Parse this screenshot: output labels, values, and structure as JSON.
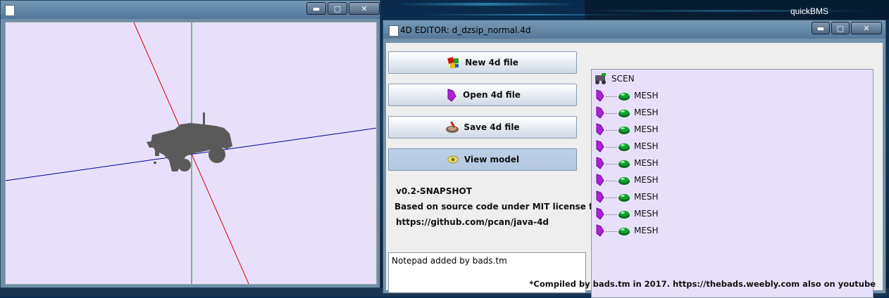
{
  "desktop": {
    "taskbar_label": "quickBMS"
  },
  "viewer_window": {
    "buttons": {
      "minimize": "▬",
      "maximize": "▢",
      "close": "✕"
    }
  },
  "editor_window": {
    "title": "4D EDITOR: d_dzsip_normal.4d",
    "buttons": {
      "minimize": "▬",
      "maximize": "▢",
      "close": "✕"
    },
    "actions": {
      "new": "New 4d file",
      "open": "Open 4d file",
      "save": "Save 4d file",
      "view": "View model"
    },
    "info": {
      "version": "v0.2-SNAPSHOT",
      "license": "Based on source code under MIT license from",
      "url": "https://github.com/pcan/java-4d"
    },
    "notepad": "Notepad added by bads.tm",
    "tree": {
      "root": "SCEN",
      "children": [
        "MESH",
        "MESH",
        "MESH",
        "MESH",
        "MESH",
        "MESH",
        "MESH",
        "MESH",
        "MESH"
      ]
    },
    "footer": "*Compiled by bads.tm in 2017. https://thebads.weebly.com also on youtube"
  },
  "colors": {
    "canvas_bg": "#e8e0fb",
    "axis_red": "#d40000",
    "axis_green": "#0a8a0a",
    "axis_blue": "#00009a",
    "model": "#5a5a5a",
    "mesh_purple": "#b020d8",
    "mesh_green": "#10a030"
  }
}
